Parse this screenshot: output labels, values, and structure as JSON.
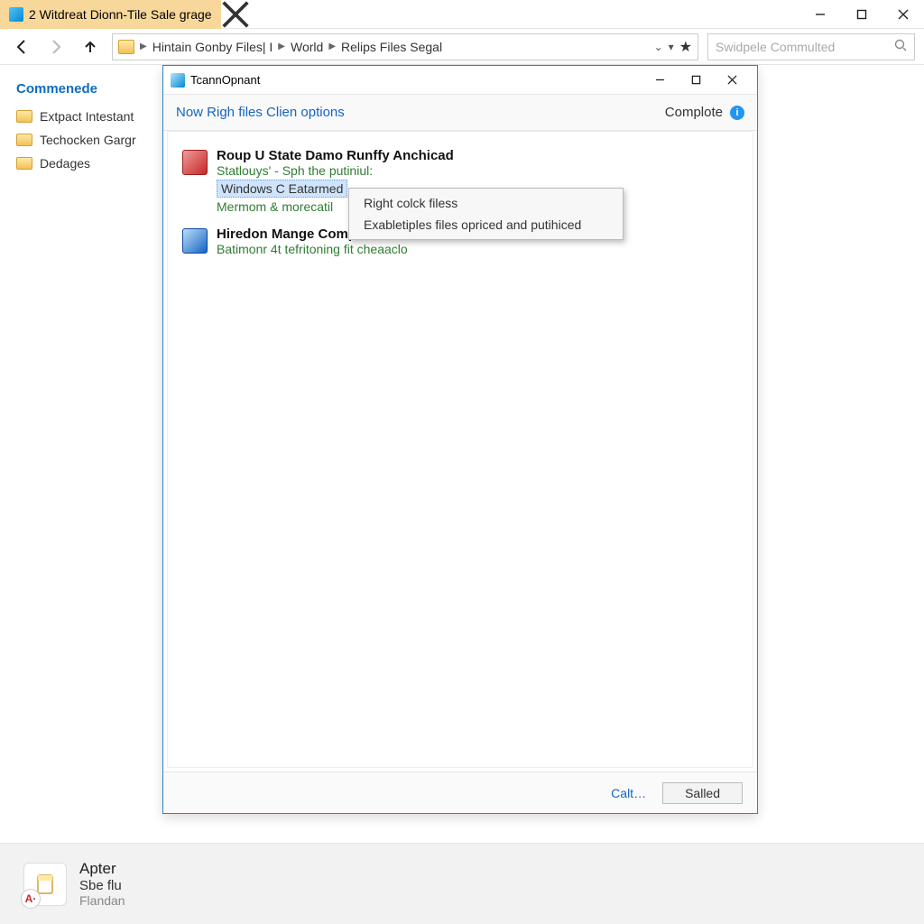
{
  "window": {
    "tab_title": "2 Witdreat Dionn-Tile Sale grage"
  },
  "nav": {
    "breadcrumb": [
      "Hintain Gonby Files| I",
      "World",
      "Relips Files Segal"
    ],
    "search_placeholder": "Swidpele Commulted"
  },
  "sidebar": {
    "heading": "Commenede",
    "items": [
      {
        "label": "Extpact Intestant"
      },
      {
        "label": "Techocken Gargr"
      },
      {
        "label": "Dedages"
      }
    ]
  },
  "dialog": {
    "title": "TcannOpnant",
    "header_link": "Now Righ files Clien options",
    "header_right": "Complote",
    "entries": [
      {
        "title": "Roup U State Damo Runffy Anchicad",
        "sub": "Statlouys' - Sph the putiniul:",
        "selected": "Windows C Eatarmed",
        "sub2": "Mermom & morecatil",
        "icon": "red"
      },
      {
        "title": "Hiredon Mange Computal Fills",
        "sub": "Batimonr 4t tefritoning fit cheaaclo",
        "icon": "blue"
      }
    ],
    "footer_link": "Calt…",
    "footer_button": "Salled"
  },
  "context_menu": {
    "items": [
      "Right colck filess",
      "Exabletiples files opriced and putihiced"
    ]
  },
  "task": {
    "badge": "A·",
    "title": "Apter",
    "sub": "Sbe flu",
    "meta": "Flandan"
  }
}
